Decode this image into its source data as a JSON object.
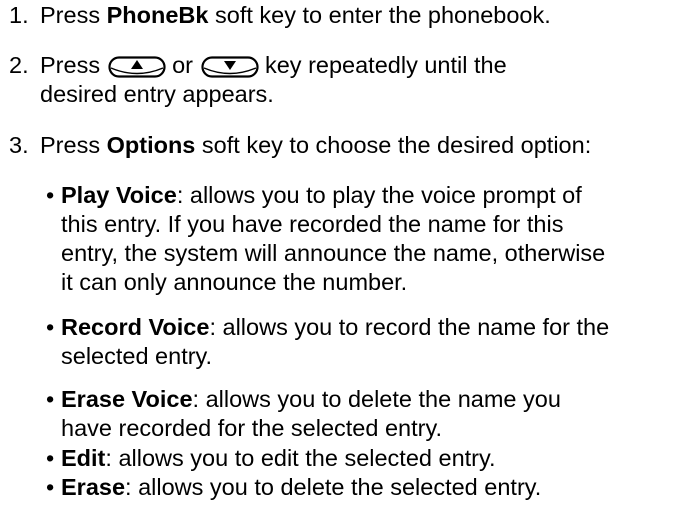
{
  "steps": [
    {
      "number": "1.",
      "pre": "Press ",
      "bold": "PhoneBk",
      "post": " soft key to enter the phonebook."
    },
    {
      "number": "2.",
      "pre": "Press",
      "up_key_icon": "up-arrow-key-icon",
      "mid": "or",
      "down_key_icon": "down-arrow-key-icon",
      "post_line1": "key repeatedly until the",
      "post_line2": "desired entry appears."
    },
    {
      "number": "3.",
      "pre": "Press ",
      "bold": "Options",
      "post": " soft key to choose the desired option:"
    }
  ],
  "options": [
    {
      "term": "Play Voice",
      "lines": [
        ": allows you to play the voice prompt of",
        "this entry. If you have recorded the name for this",
        "entry, the system will announce the name, otherwise",
        "it can only announce the number."
      ]
    },
    {
      "term": "Record Voice",
      "lines": [
        ": allows you to record the name for the",
        "selected entry."
      ]
    },
    {
      "term": "Erase Voice",
      "lines": [
        ": allows you to delete the name you",
        "have recorded for the selected entry."
      ]
    },
    {
      "term": "Edit",
      "lines": [
        ": allows you to edit the selected entry."
      ]
    },
    {
      "term": "Erase",
      "lines": [
        ": allows you to delete the selected entry."
      ]
    }
  ],
  "bullet_char": "•"
}
